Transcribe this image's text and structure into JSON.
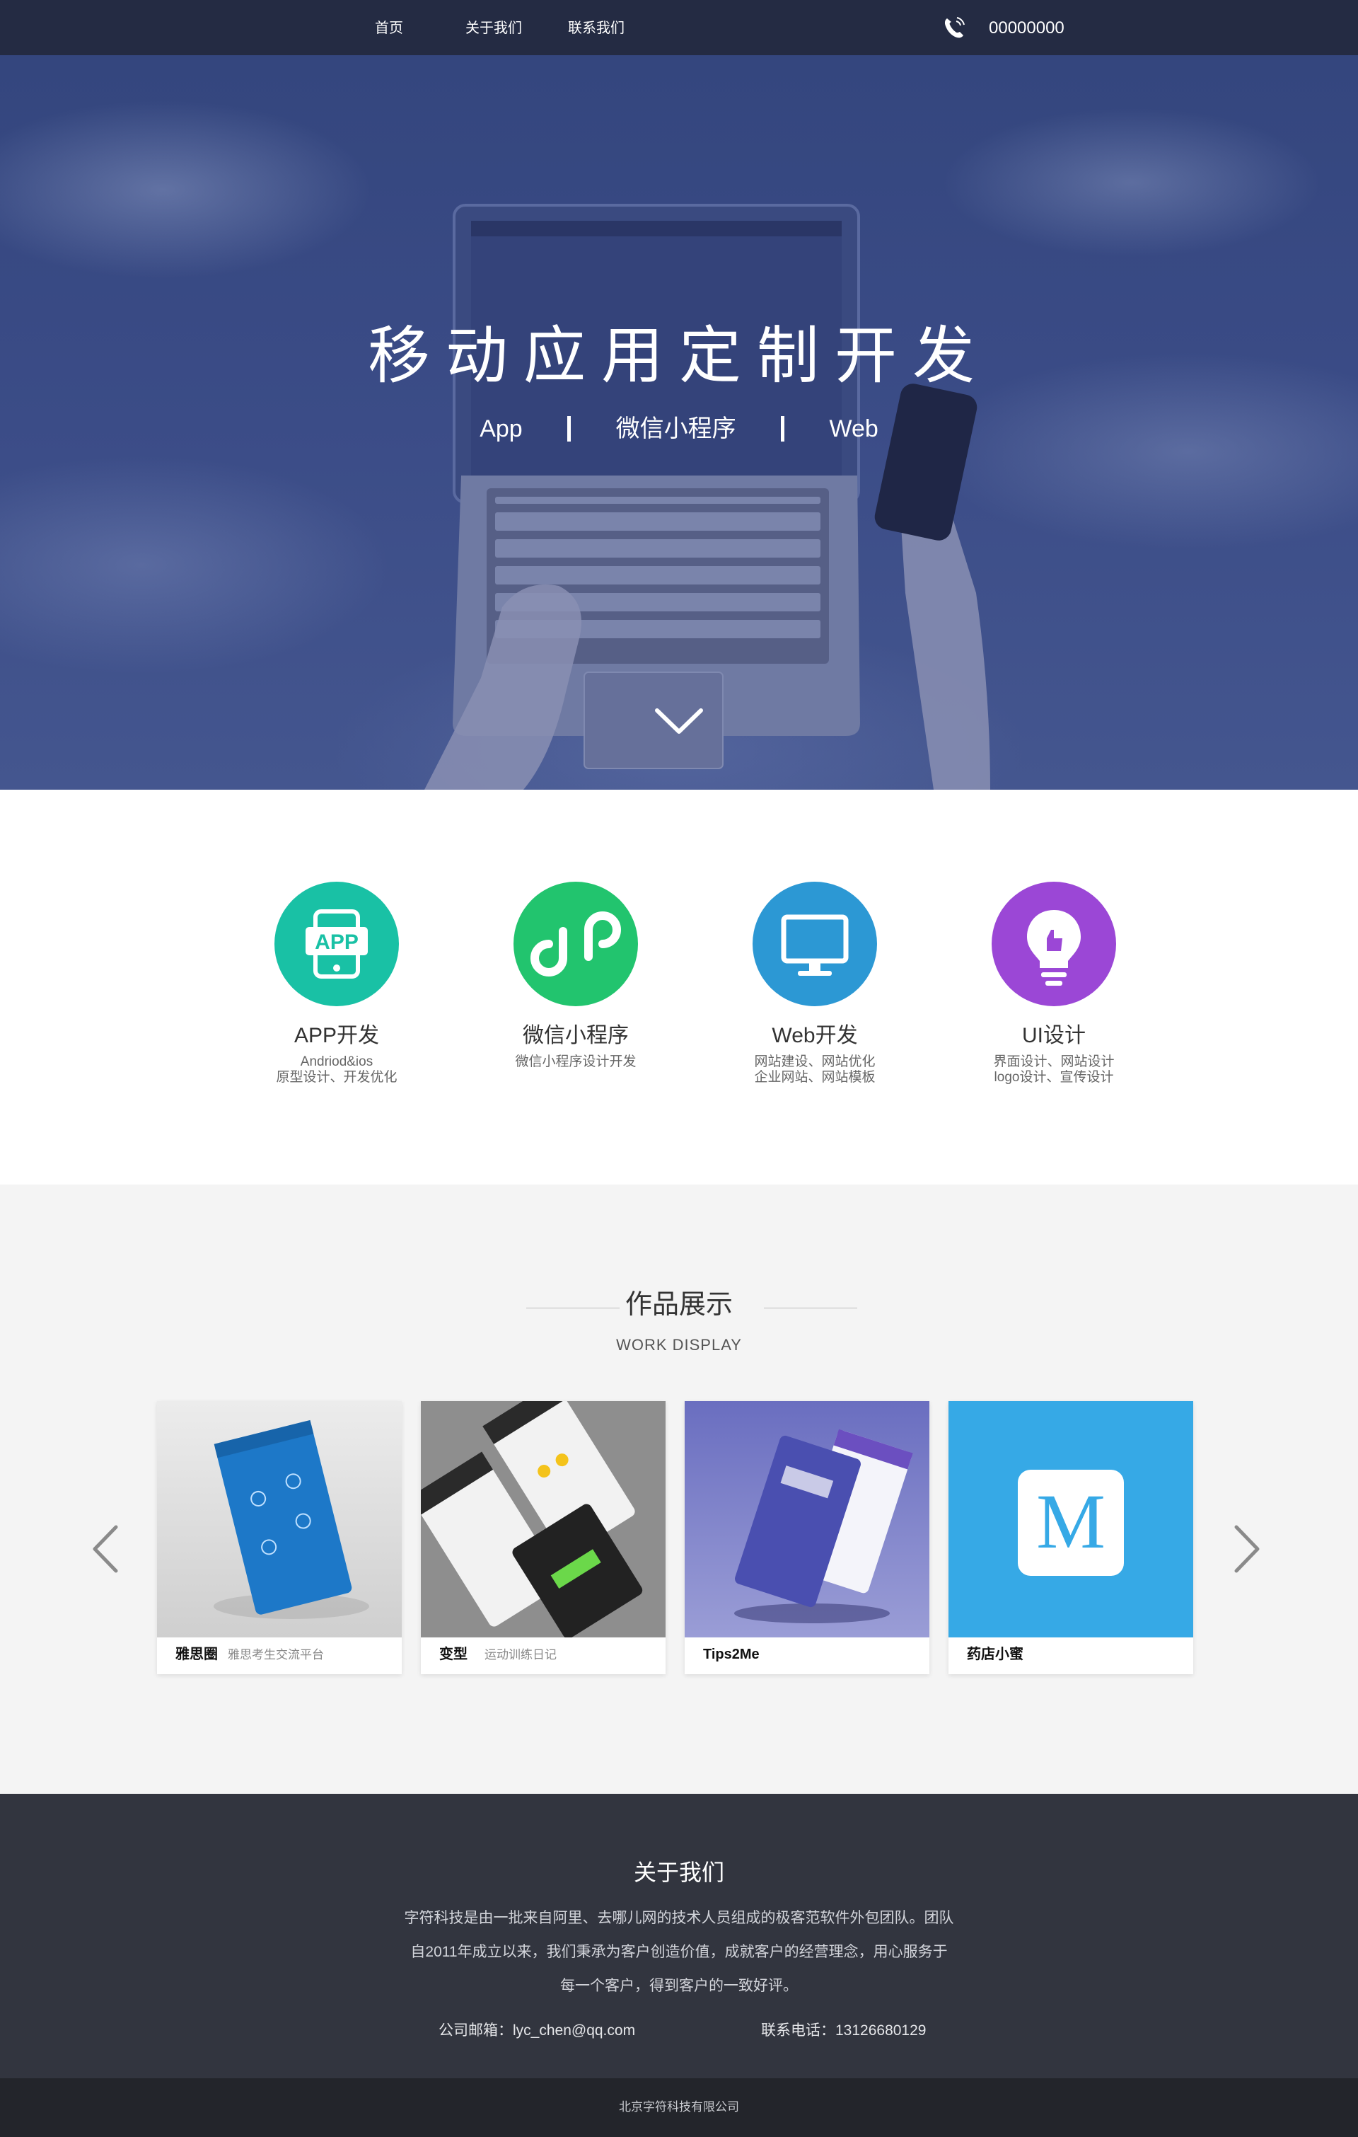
{
  "nav": {
    "items": [
      {
        "label": "首页"
      },
      {
        "label": "关于我们"
      },
      {
        "label": "联系我们"
      }
    ],
    "phone": "00000000",
    "phone_icon": "phone-icon"
  },
  "hero": {
    "title": "移动应用定制开发",
    "subtitles": [
      "App",
      "微信小程序",
      "Web"
    ],
    "scroll_icon": "chevron-down-icon"
  },
  "services": [
    {
      "icon": "app-icon",
      "color": "#19c1a5",
      "title": "APP开发",
      "desc": [
        "Andriod&ios",
        "原型设计、开发优化"
      ]
    },
    {
      "icon": "miniprogram-icon",
      "color": "#22c46e",
      "title": "微信小程序",
      "desc": [
        "微信小程序设计开发",
        ""
      ]
    },
    {
      "icon": "monitor-icon",
      "color": "#2c98d4",
      "title": "Web开发",
      "desc": [
        "网站建设、网站优化",
        "企业网站、网站模板"
      ]
    },
    {
      "icon": "lightbulb-icon",
      "color": "#9b47d6",
      "title": "UI设计",
      "desc": [
        "界面设计、网站设计",
        "logo设计、宣传设计"
      ]
    }
  ],
  "works": {
    "title": "作品展示",
    "subtitle": "WORK DISPLAY",
    "items": [
      {
        "name": "雅思圈",
        "desc": "雅思考生交流平台"
      },
      {
        "name": "变型",
        "desc": "运动训练日记"
      },
      {
        "name": "Tips2Me",
        "desc": ""
      },
      {
        "name": "药店小蜜",
        "desc": ""
      }
    ],
    "logo_letter": "M",
    "prev_icon": "chevron-left-icon",
    "next_icon": "chevron-right-icon"
  },
  "about": {
    "title": "关于我们",
    "lines": [
      "字符科技是由一批来自阿里、去哪儿网的技术人员组成的极客范软件外包团队。团队",
      "自2011年成立以来，我们秉承为客户创造价值，成就客户的经营理念，用心服务于",
      "每一个客户，得到客户的一致好评。"
    ],
    "email": "公司邮箱：lyc_chen@qq.com",
    "phone": "联系电话：13126680129"
  },
  "footer": {
    "company": "北京字符科技有限公司"
  },
  "colors": {
    "nav_bg": "#242b43",
    "hero_bg": "#3b4c87",
    "works_bg": "#f4f4f4",
    "about_bg": "#32353f",
    "footer_bg": "#23252b"
  }
}
